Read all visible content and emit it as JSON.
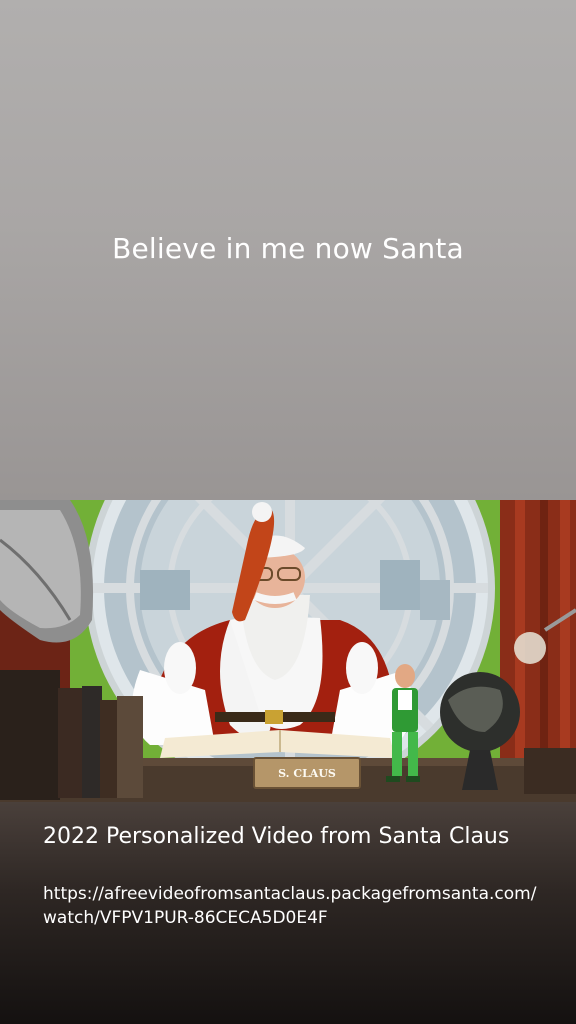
{
  "story": {
    "text": "Believe in me now Santa"
  },
  "link_preview": {
    "title": "2022 Personalized Video from Santa Claus",
    "url": "https://afreevideofromsantaclaus.packagefromsanta.com/watch/VFPV1PUR-86CECA5D0E4F",
    "sign_text": "S. CLAUS"
  },
  "colors": {
    "top_gradient": "#a9a6a5",
    "bottom_gradient": "#2e2724",
    "text": "#ffffff"
  }
}
